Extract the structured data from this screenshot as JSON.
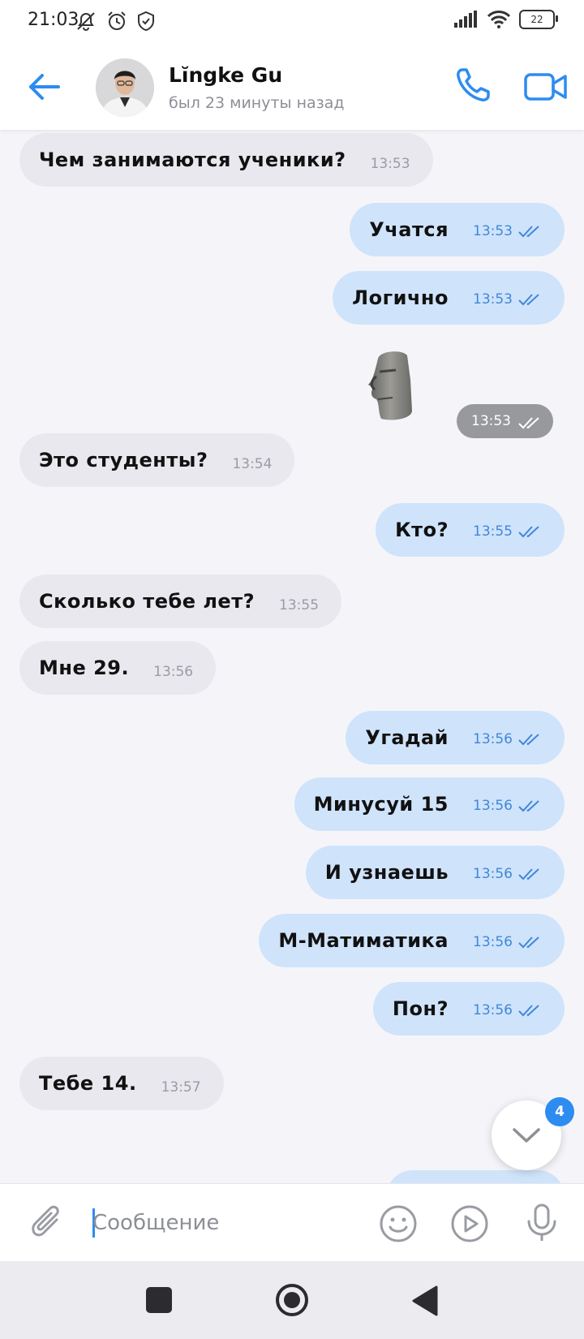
{
  "status_bar": {
    "time": "21:03",
    "battery": "22",
    "icons": [
      "mute-icon",
      "alarm-icon",
      "shield-icon",
      "signal-icon",
      "wifi-icon",
      "battery-icon"
    ]
  },
  "header": {
    "contact_name": "Lĭngke Gu",
    "last_seen": "был 23 минуты назад",
    "icons": [
      "back-arrow-icon",
      "phone-icon",
      "video-camera-icon"
    ]
  },
  "messages": [
    {
      "dir": "in",
      "text": "Чем занимаются ученики?",
      "time": "13:53"
    },
    {
      "dir": "out",
      "text": "Учатся",
      "time": "13:53",
      "read": true
    },
    {
      "dir": "out",
      "text": "Логично",
      "time": "13:53",
      "read": true
    },
    {
      "dir": "out",
      "type": "sticker",
      "sticker": "moai-stone-head",
      "time": "13:53",
      "read": true
    },
    {
      "dir": "in",
      "text": "Это студенты?",
      "time": "13:54"
    },
    {
      "dir": "out",
      "text": "Кто?",
      "time": "13:55",
      "read": true
    },
    {
      "dir": "in",
      "text": "Сколько тебе лет?",
      "time": "13:55"
    },
    {
      "dir": "in",
      "text": "Мне 29.",
      "time": "13:56"
    },
    {
      "dir": "out",
      "text": "Угадай",
      "time": "13:56",
      "read": true
    },
    {
      "dir": "out",
      "text": "Минусуй 15",
      "time": "13:56",
      "read": true
    },
    {
      "dir": "out",
      "text": "И узнаешь",
      "time": "13:56",
      "read": true
    },
    {
      "dir": "out",
      "text": "М-Матиматика",
      "time": "13:56",
      "read": true
    },
    {
      "dir": "out",
      "text": "Пон?",
      "time": "13:56",
      "read": true
    },
    {
      "dir": "in",
      "text": "Тебе 14.",
      "time": "13:57"
    }
  ],
  "scroll_button": {
    "unread_count": "4",
    "icon": "chevron-down-icon"
  },
  "composer": {
    "placeholder": "Сообщение",
    "value": "",
    "icons": [
      "paperclip-icon",
      "smiley-icon",
      "play-circle-icon",
      "microphone-icon"
    ]
  },
  "nav_bar": {
    "icons": [
      "recents-square-icon",
      "home-circle-icon",
      "back-triangle-icon"
    ]
  },
  "colors": {
    "accent": "#2d8cf0",
    "outgoing_bubble": "#cfe3fb",
    "incoming_bubble": "#e8e8ee",
    "chat_background": "#f5f5f9"
  }
}
